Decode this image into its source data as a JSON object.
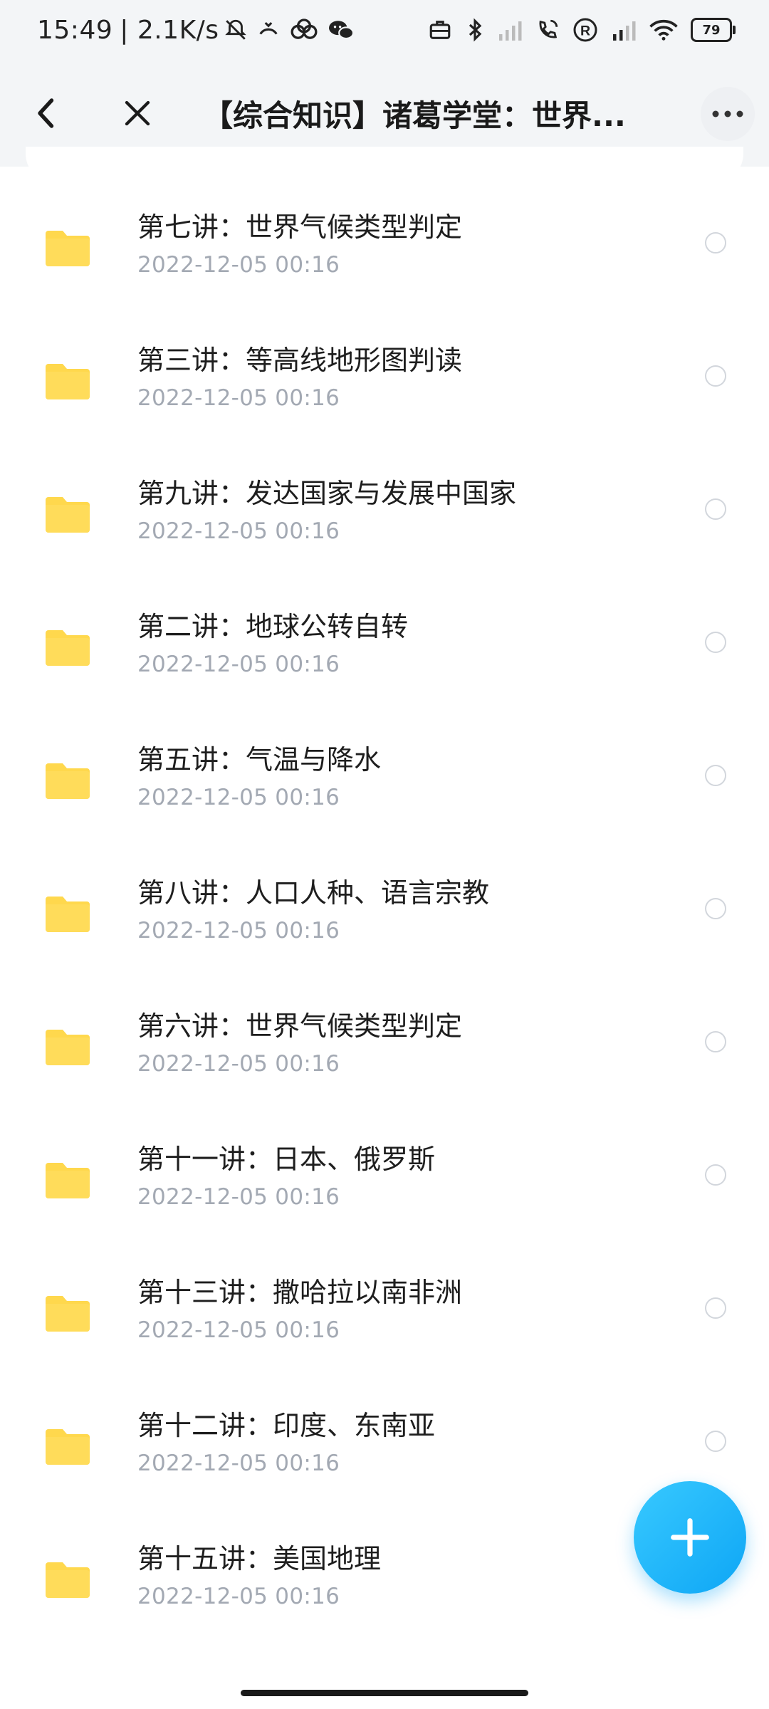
{
  "status_bar": {
    "time": "15:49",
    "speed": "| 2.1K/s",
    "battery": "79",
    "icons": [
      "mute-icon",
      "call-forward-icon",
      "cloud-icon",
      "wechat-icon",
      "briefcase-icon",
      "bluetooth-icon",
      "signal-icon",
      "wifi-call-icon",
      "registered-icon",
      "signal-icon",
      "wifi-icon",
      "battery-icon"
    ]
  },
  "header": {
    "title": "【综合知识】诸葛学堂：世界...",
    "back_icon": "chevron-left-icon",
    "close_icon": "close-icon",
    "more_icon": "more-horizontal-icon"
  },
  "colors": {
    "folder": "#FFD84D",
    "fab": "#18B2F8",
    "date": "#A3A9B3",
    "header_bg": "#F3F5F7"
  },
  "files": [
    {
      "name": "第七讲：世界气候类型判定",
      "date": "2022-12-05  00:16"
    },
    {
      "name": "第三讲：等高线地形图判读",
      "date": "2022-12-05  00:16"
    },
    {
      "name": "第九讲：发达国家与发展中国家",
      "date": "2022-12-05  00:16"
    },
    {
      "name": "第二讲：地球公转自转",
      "date": "2022-12-05  00:16"
    },
    {
      "name": "第五讲：气温与降水",
      "date": "2022-12-05  00:16"
    },
    {
      "name": "第八讲：人口人种、语言宗教",
      "date": "2022-12-05  00:16"
    },
    {
      "name": "第六讲：世界气候类型判定",
      "date": "2022-12-05  00:16"
    },
    {
      "name": "第十一讲：日本、俄罗斯",
      "date": "2022-12-05  00:16"
    },
    {
      "name": "第十三讲：撒哈拉以南非洲",
      "date": "2022-12-05  00:16"
    },
    {
      "name": "第十二讲：印度、东南亚",
      "date": "2022-12-05  00:16"
    },
    {
      "name": "第十五讲：美国地理",
      "date": "2022-12-05  00:16"
    }
  ],
  "fab_icon": "plus-icon"
}
